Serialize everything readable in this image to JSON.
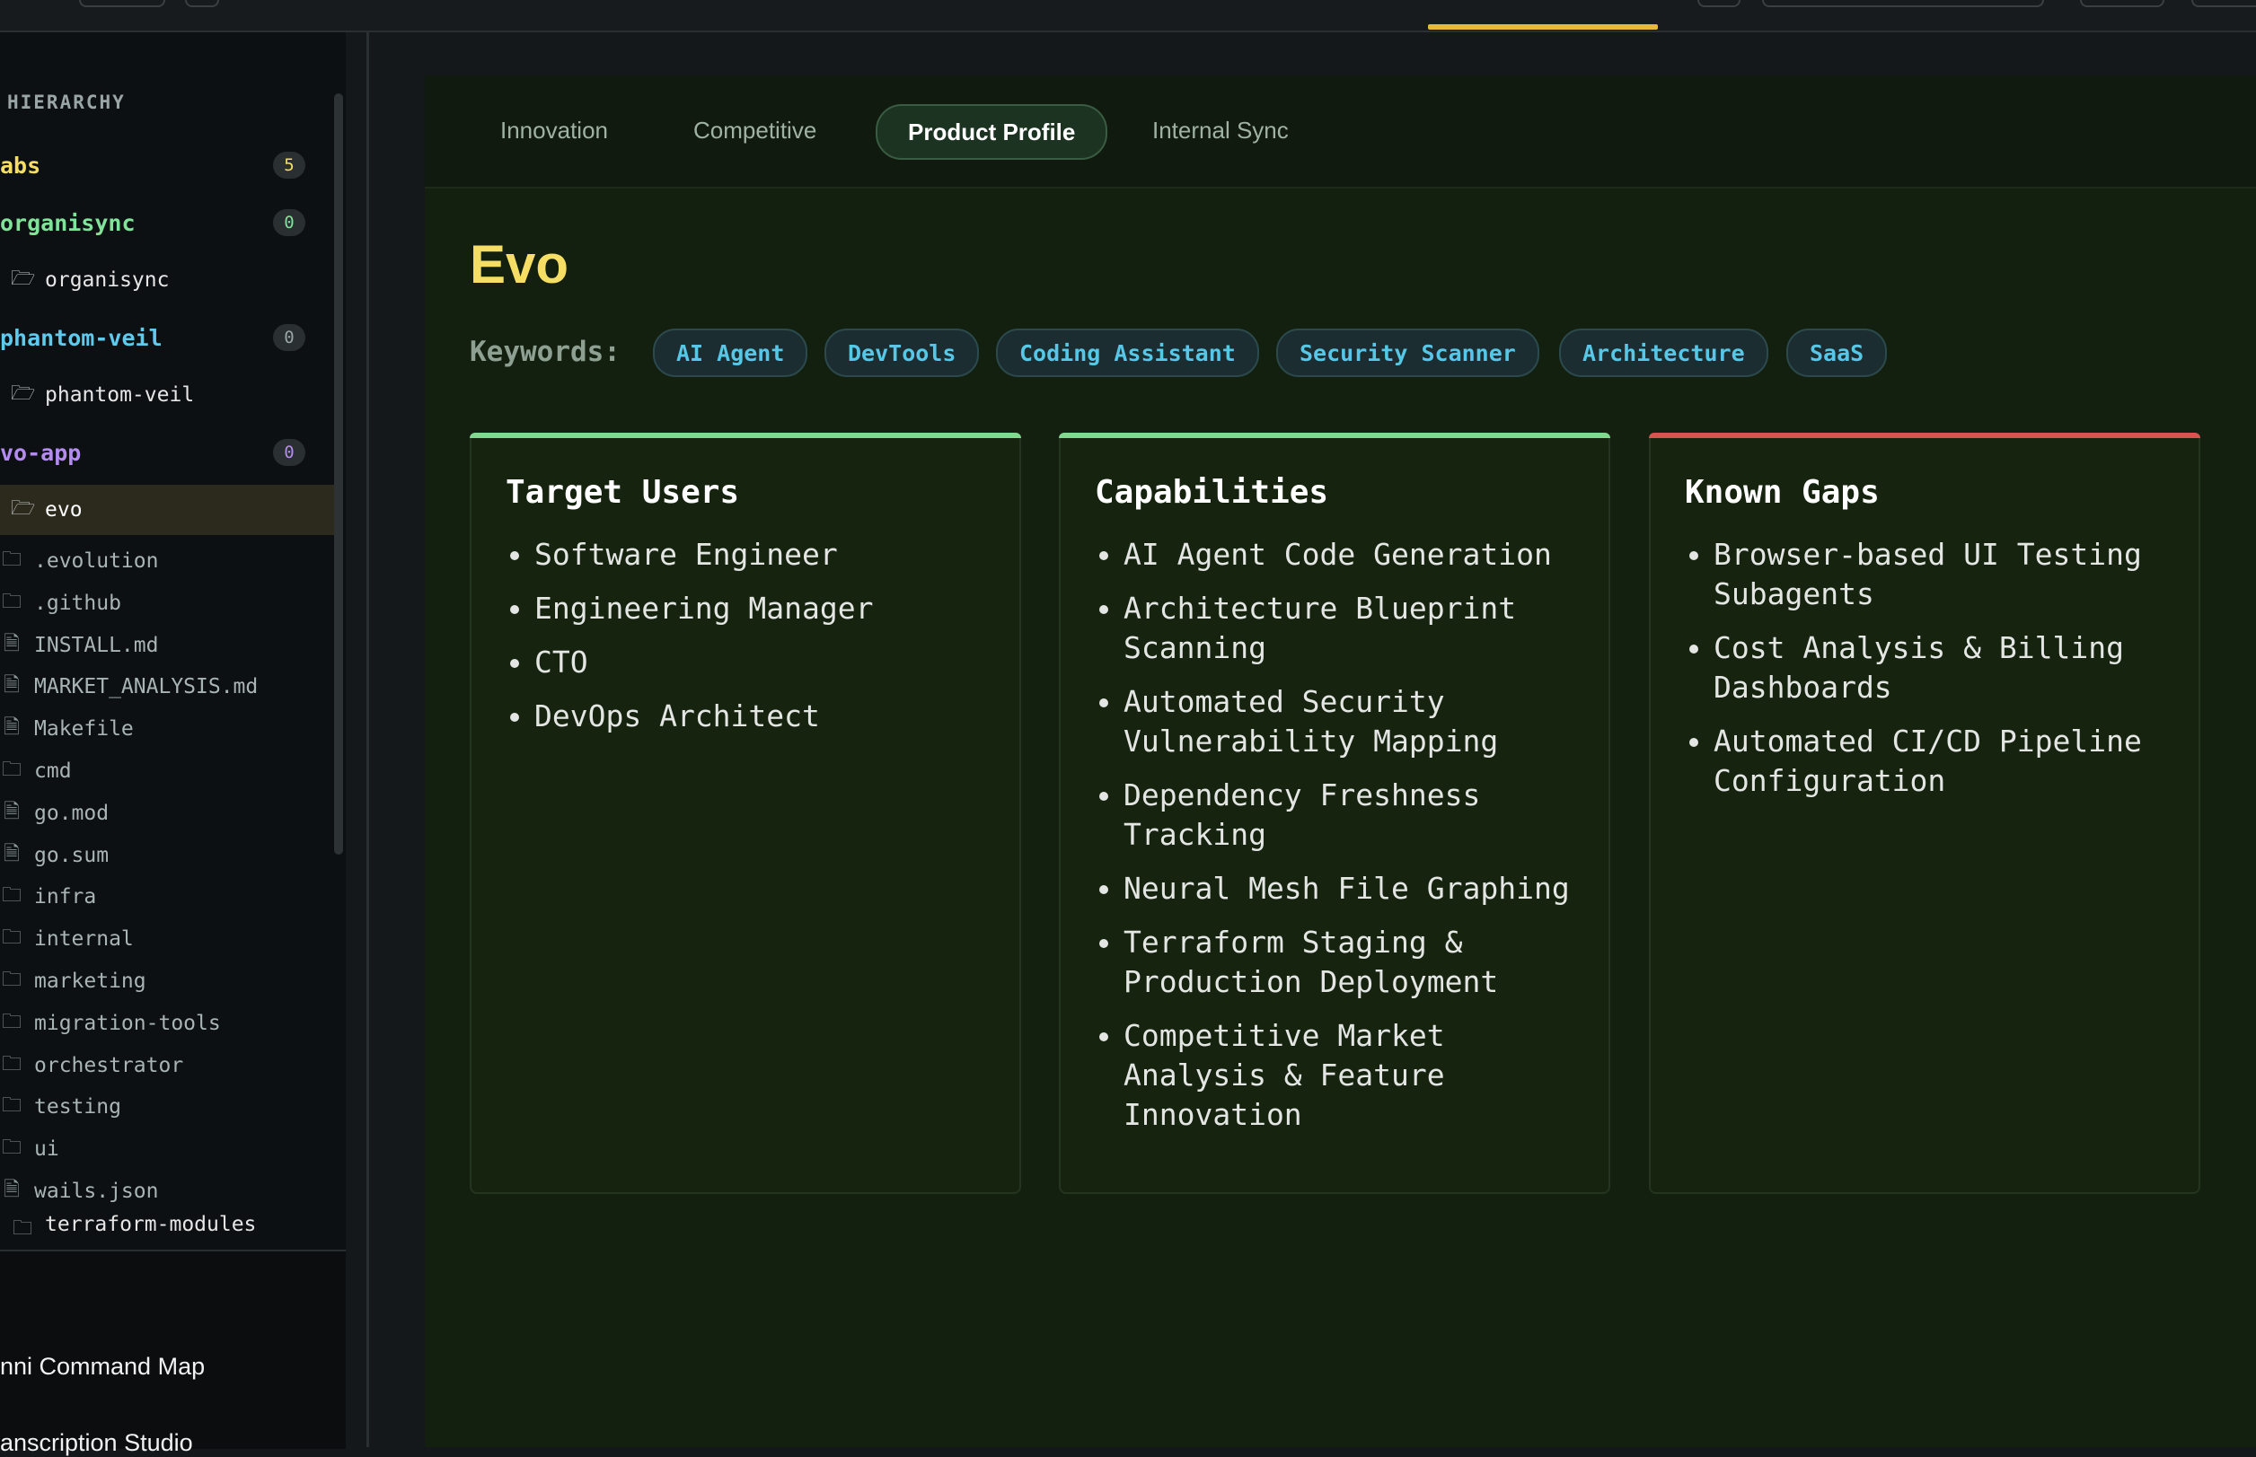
{
  "sidebar": {
    "heading": "HIERARCHY",
    "groups": [
      {
        "label": "abs",
        "count": "5"
      },
      {
        "label": "organisync",
        "count": "0",
        "child": "organisync"
      },
      {
        "label": "phantom-veil",
        "count": "0",
        "child": "phantom-veil"
      },
      {
        "label": "vo-app",
        "count": "0",
        "child": "evo"
      }
    ],
    "files": [
      {
        "label": ".evolution",
        "kind": "folder"
      },
      {
        "label": ".github",
        "kind": "folder"
      },
      {
        "label": "INSTALL.md",
        "kind": "file"
      },
      {
        "label": "MARKET_ANALYSIS.md",
        "kind": "file"
      },
      {
        "label": "Makefile",
        "kind": "file"
      },
      {
        "label": "cmd",
        "kind": "folder"
      },
      {
        "label": "go.mod",
        "kind": "file"
      },
      {
        "label": "go.sum",
        "kind": "file"
      },
      {
        "label": "infra",
        "kind": "folder"
      },
      {
        "label": "internal",
        "kind": "folder"
      },
      {
        "label": "marketing",
        "kind": "folder"
      },
      {
        "label": "migration-tools",
        "kind": "folder"
      },
      {
        "label": "orchestrator",
        "kind": "folder"
      },
      {
        "label": "testing",
        "kind": "folder"
      },
      {
        "label": "ui",
        "kind": "folder"
      },
      {
        "label": "wails.json",
        "kind": "file"
      },
      {
        "label": "terraform-modules",
        "kind": "folder"
      }
    ],
    "bottom_items": [
      "nni Command Map",
      "anscription Studio"
    ]
  },
  "tabs": [
    {
      "label": "Innovation"
    },
    {
      "label": "Competitive"
    },
    {
      "label": "Product Profile",
      "active": true
    },
    {
      "label": "Internal Sync"
    }
  ],
  "product": {
    "name": "Evo",
    "keywords_label": "Keywords:",
    "keywords": [
      "AI Agent",
      "DevTools",
      "Coding Assistant",
      "Security Scanner",
      "Architecture",
      "SaaS"
    ]
  },
  "cards": [
    {
      "title": "Target Users",
      "accent": "#7fd98f",
      "items": [
        "Software Engineer",
        "Engineering Manager",
        "CTO",
        "DevOps Architect"
      ]
    },
    {
      "title": "Capabilities",
      "accent": "#7fd98f",
      "items": [
        "AI Agent Code Generation",
        "Architecture Blueprint Scanning",
        "Automated Security Vulnerability Mapping",
        "Dependency Freshness Tracking",
        "Neural Mesh File Graphing",
        "Terraform Staging & Production Deployment",
        "Competitive Market Analysis & Feature Innovation"
      ]
    },
    {
      "title": "Known Gaps",
      "accent": "#d9534f",
      "items": [
        "Browser-based UI Testing Subagents",
        "Cost Analysis & Billing Dashboards",
        "Automated CI/CD Pipeline Configuration"
      ]
    }
  ],
  "colors": {
    "title": "#f5de63",
    "keyword": "#56c7e6",
    "group_yellow": "#f5de63",
    "group_green": "#7fe39a",
    "group_blue": "#5fc9ee",
    "group_purple": "#b48cf0"
  }
}
